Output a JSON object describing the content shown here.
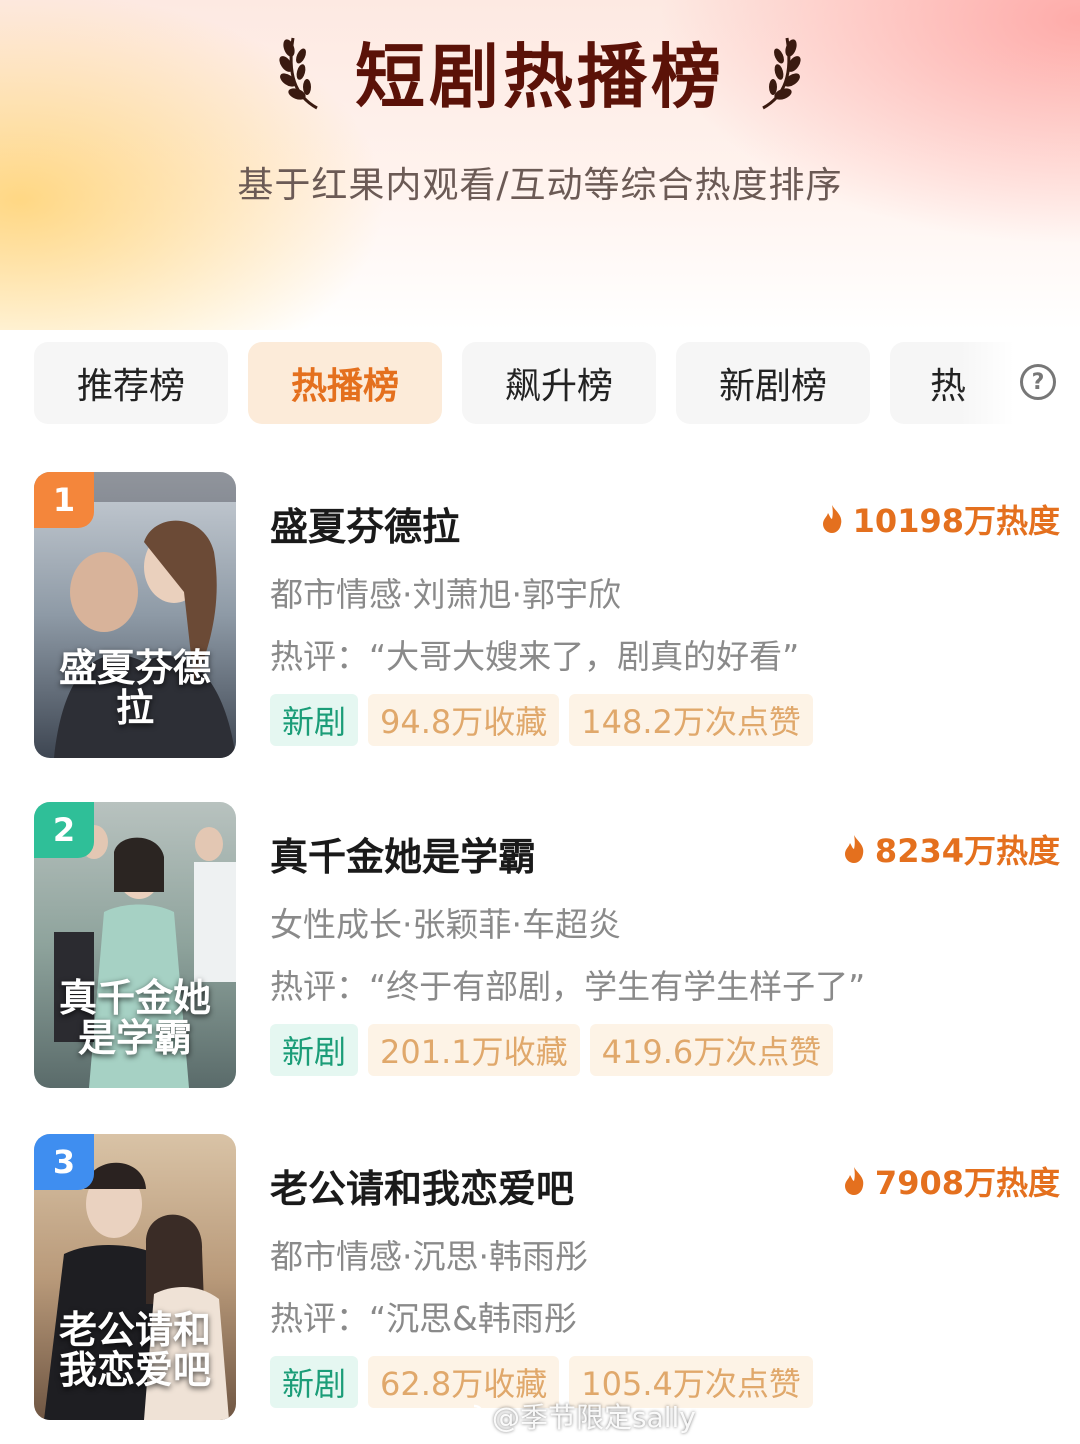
{
  "header": {
    "title": "短剧热播榜",
    "subtitle": "基于红果内观看/互动等综合热度排序"
  },
  "tabs": [
    {
      "label": "推荐榜",
      "active": false
    },
    {
      "label": "热播榜",
      "active": true
    },
    {
      "label": "飙升榜",
      "active": false
    },
    {
      "label": "新剧榜",
      "active": false
    },
    {
      "label": "热",
      "active": false
    }
  ],
  "help": {
    "symbol": "?"
  },
  "items": [
    {
      "rank": "1",
      "rank_color": "#f4863b",
      "poster_text": "盛夏芬德拉",
      "title": "盛夏芬德拉",
      "heat": "10198万热度",
      "tags": "都市情感·刘萧旭·郭宇欣",
      "comment": "热评：“大哥大嫂来了，剧真的好看”",
      "badge_new": "新剧",
      "collect": "94.8万收藏",
      "likes": "148.2万次点赞"
    },
    {
      "rank": "2",
      "rank_color": "#2fbf98",
      "poster_text": "真千金她是学霸",
      "title": "真千金她是学霸",
      "heat": "8234万热度",
      "tags": "女性成长·张颖菲·车超炎",
      "comment": "热评：“终于有部剧，学生有学生样子了”",
      "badge_new": "新剧",
      "collect": "201.1万收藏",
      "likes": "419.6万次点赞"
    },
    {
      "rank": "3",
      "rank_color": "#3f8ef0",
      "poster_text": "老公请和我恋爱吧",
      "title": "老公请和我恋爱吧",
      "heat": "7908万热度",
      "tags": "都市情感·沉思·韩雨彤",
      "comment": "热评：“沉思&韩雨彤",
      "badge_new": "新剧",
      "collect": "62.8万收藏",
      "likes": "105.4万次点赞"
    }
  ],
  "watermark": {
    "text": "@季节限定sally"
  },
  "colors": {
    "accent": "#e4701e",
    "title": "#5b1208",
    "new_badge": "#1b9d78"
  }
}
